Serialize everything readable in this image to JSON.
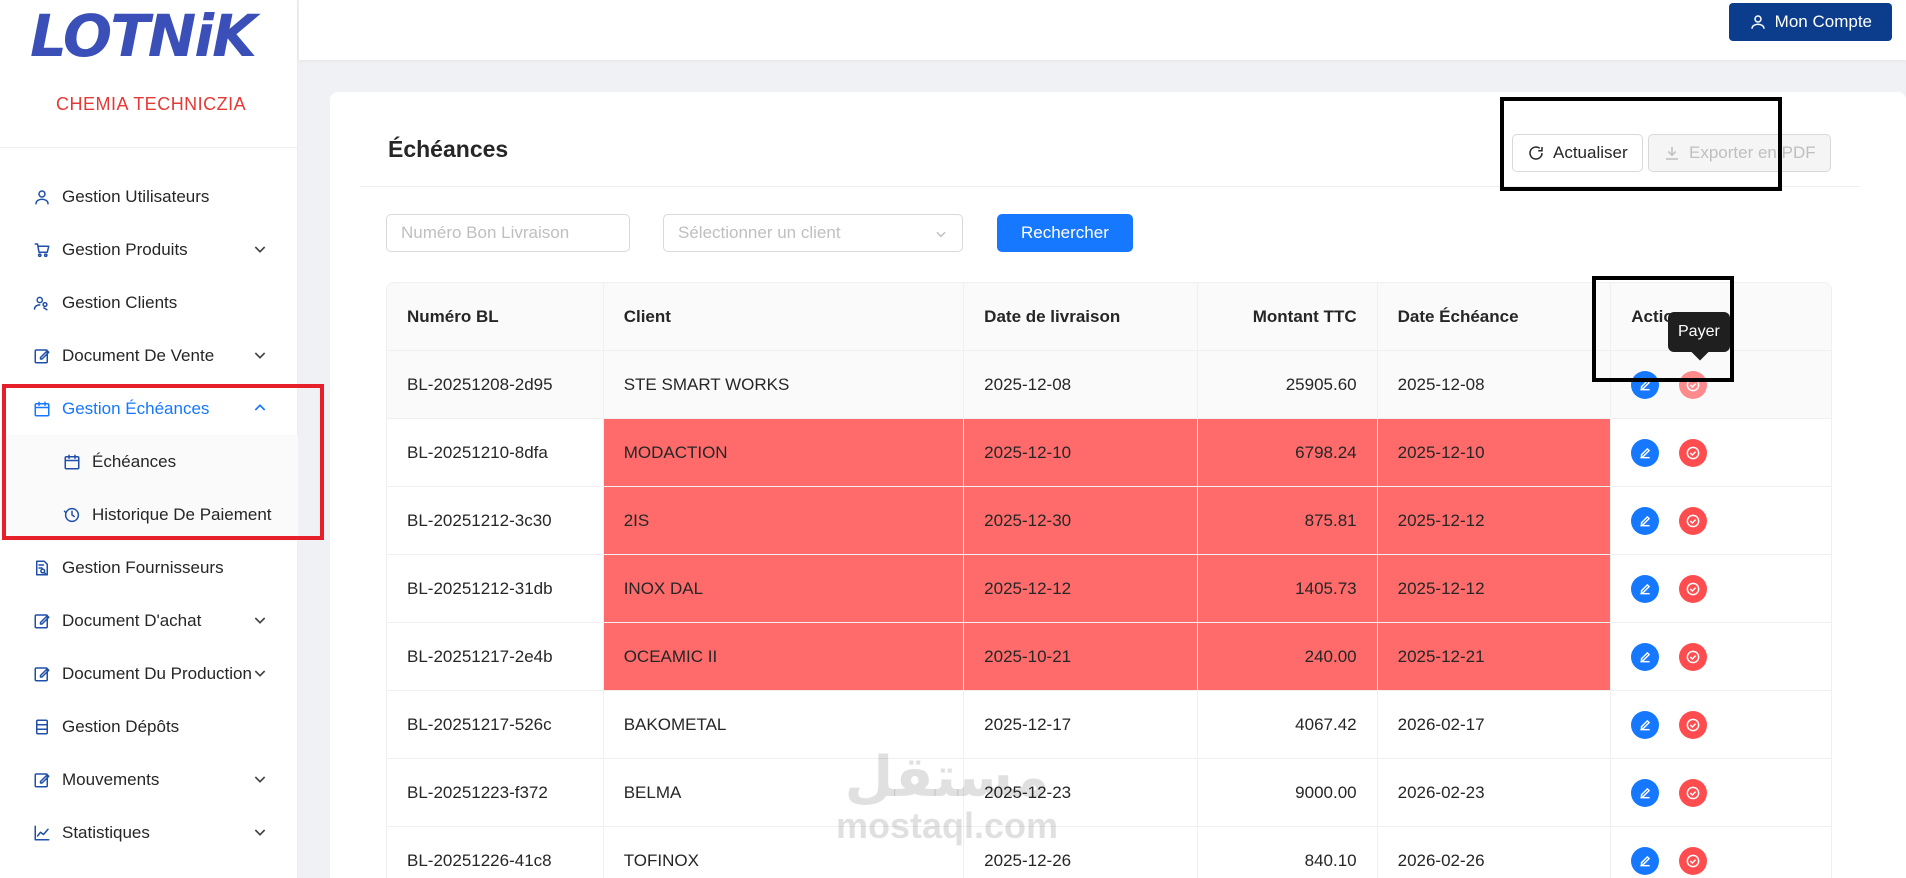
{
  "brand": {
    "logo": "LOTNiK",
    "subtitle": "CHEMIA TECHNICZIA"
  },
  "sidebar": {
    "items": [
      {
        "label": "Gestion Utilisateurs",
        "icon": "user-icon"
      },
      {
        "label": "Gestion Produits",
        "icon": "cart-icon",
        "has_caret": true
      },
      {
        "label": "Gestion Clients",
        "icon": "users-icon"
      },
      {
        "label": "Document De Vente",
        "icon": "edit-icon",
        "has_caret": true
      },
      {
        "label": "Gestion Échéances",
        "icon": "calendar-icon",
        "active": true,
        "expanded": true
      },
      {
        "label": "Gestion Fournisseurs",
        "icon": "file-search-icon"
      },
      {
        "label": "Document D'achat",
        "icon": "edit-icon",
        "has_caret": true
      },
      {
        "label": "Document Du Production",
        "icon": "edit-icon",
        "has_caret": true
      },
      {
        "label": "Gestion Dépôts",
        "icon": "database-icon"
      },
      {
        "label": "Mouvements",
        "icon": "edit-icon",
        "has_caret": true
      },
      {
        "label": "Statistiques",
        "icon": "chart-icon",
        "has_caret": true
      }
    ],
    "submenu": [
      {
        "label": "Échéances",
        "icon": "calendar-icon"
      },
      {
        "label": "Historique De Paiement",
        "icon": "history-icon"
      }
    ]
  },
  "topbar": {
    "account_label": "Mon Compte"
  },
  "page": {
    "title": "Échéances",
    "refresh_label": "Actualiser",
    "export_label": "Exporter en PDF",
    "bl_placeholder": "Numéro Bon Livraison",
    "client_placeholder": "Sélectionner un client",
    "search_label": "Rechercher"
  },
  "table": {
    "columns": [
      "Numéro BL",
      "Client",
      "Date de livraison",
      "Montant TTC",
      "Date Échéance",
      "Actions"
    ],
    "rows": [
      {
        "bl": "BL-20251208-2d95",
        "client": "STE SMART WORKS",
        "livraison": "2025-12-08",
        "montant": "25905.60",
        "echeance": "2025-12-08",
        "overdue": false
      },
      {
        "bl": "BL-20251210-8dfa",
        "client": "MODACTION",
        "livraison": "2025-12-10",
        "montant": "6798.24",
        "echeance": "2025-12-10",
        "overdue": true
      },
      {
        "bl": "BL-20251212-3c30",
        "client": "2IS",
        "livraison": "2025-12-30",
        "montant": "875.81",
        "echeance": "2025-12-12",
        "overdue": true
      },
      {
        "bl": "BL-20251212-31db",
        "client": "INOX DAL",
        "livraison": "2025-12-12",
        "montant": "1405.73",
        "echeance": "2025-12-12",
        "overdue": true
      },
      {
        "bl": "BL-20251217-2e4b",
        "client": "OCEAMIC II",
        "livraison": "2025-10-21",
        "montant": "240.00",
        "echeance": "2025-12-21",
        "overdue": true
      },
      {
        "bl": "BL-20251217-526c",
        "client": "BAKOMETAL",
        "livraison": "2025-12-17",
        "montant": "4067.42",
        "echeance": "2026-02-17",
        "overdue": false
      },
      {
        "bl": "BL-20251223-f372",
        "client": "BELMA",
        "livraison": "2025-12-23",
        "montant": "9000.00",
        "echeance": "2026-02-23",
        "overdue": false
      },
      {
        "bl": "BL-20251226-41c8",
        "client": "TOFINOX",
        "livraison": "2025-12-26",
        "montant": "840.10",
        "echeance": "2026-02-26",
        "overdue": false
      }
    ]
  },
  "tooltip": "Payer",
  "watermark": {
    "arabic": "مستقل",
    "latin": "mostaql.com"
  },
  "colors": {
    "primary": "#1677ff",
    "navy": "#0b3d8c",
    "overdue": "#ff6b6b",
    "danger": "#ff4d4f",
    "brand_red": "#e53935",
    "brand_blue": "#3a4fb8"
  }
}
